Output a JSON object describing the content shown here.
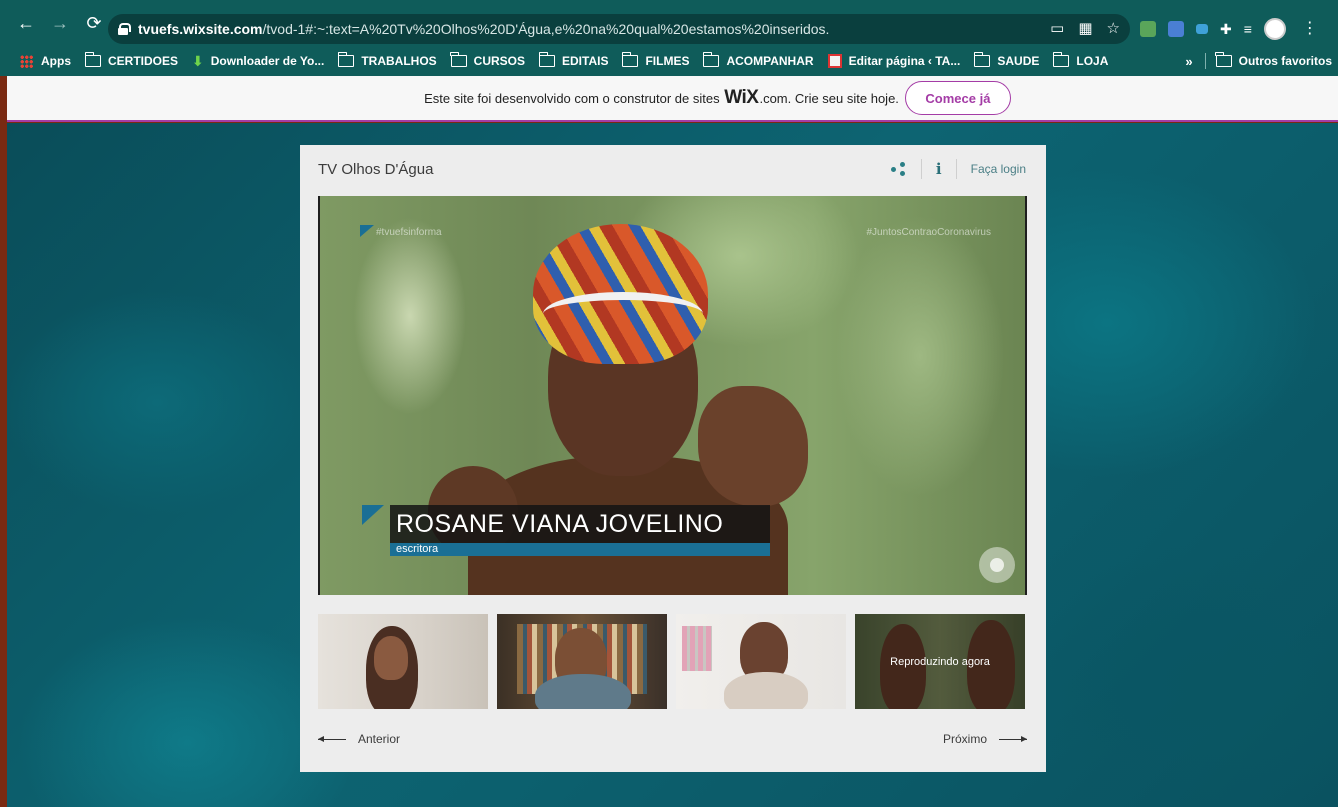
{
  "browser": {
    "url_host": "tvuefs.wixsite.com",
    "url_rest": "/tvod-1#:~:text=A%20Tv%20Olhos%20D'Água,e%20na%20qual%20estamos%20inseridos.",
    "bookmarks": [
      {
        "label": "Apps",
        "icon": "apps-icon"
      },
      {
        "label": "CERTIDOES",
        "icon": "folder-icon"
      },
      {
        "label": "Downloader de Yo...",
        "icon": "download-icon"
      },
      {
        "label": "TRABALHOS",
        "icon": "folder-icon"
      },
      {
        "label": "CURSOS",
        "icon": "folder-icon"
      },
      {
        "label": "EDITAIS",
        "icon": "folder-icon"
      },
      {
        "label": "FILMES",
        "icon": "folder-icon"
      },
      {
        "label": "ACOMPANHAR",
        "icon": "folder-icon"
      },
      {
        "label": "Editar página ‹ TA...",
        "icon": "page-icon"
      },
      {
        "label": "SAUDE",
        "icon": "folder-icon"
      },
      {
        "label": "LOJA",
        "icon": "folder-icon"
      }
    ],
    "more_label": "»",
    "other_bookmarks": "Outros favoritos"
  },
  "wix_banner": {
    "text_before": "Este site foi desenvolvido com o construtor de sites",
    "logo": "WiX",
    "text_after": ".com. Crie seu site hoje.",
    "cta": "Comece já"
  },
  "player": {
    "title": "TV Olhos D'Água",
    "info_label": "i",
    "login": "Faça login",
    "watermark_left": "#tvuefsinforma",
    "watermark_right": "#JuntosContraoCoronavirus",
    "speaker_name": "ROSANE VIANA JOVELINO",
    "speaker_role": "escritora",
    "now_playing": "Reproduzindo agora",
    "prev": "Anterior",
    "next": "Próximo"
  },
  "colors": {
    "chrome": "#0f5c5a",
    "wix_accent": "#a43ca6",
    "lower_third": "#1a6f95"
  }
}
